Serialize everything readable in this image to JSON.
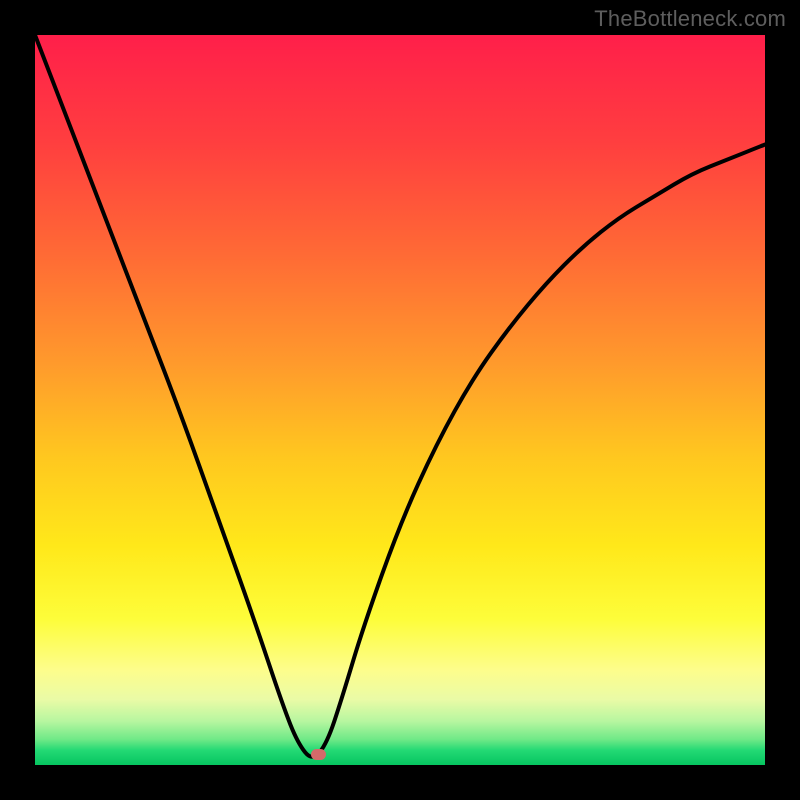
{
  "watermark": "TheBottleneck.com",
  "colors": {
    "frame": "#000000",
    "curve": "#000000",
    "marker": "#d46a6a"
  },
  "chart_data": {
    "type": "line",
    "title": "",
    "xlabel": "",
    "ylabel": "",
    "xlim": [
      0,
      100
    ],
    "ylim": [
      0,
      100
    ],
    "note": "Axes are unlabeled; x/y values below are read as percentage of plot width/height from bottom-left. Curve is a V-shape with minimum near x≈38.",
    "x": [
      0,
      5,
      10,
      15,
      20,
      25,
      30,
      34,
      36,
      38,
      40,
      42,
      45,
      50,
      55,
      60,
      65,
      70,
      75,
      80,
      85,
      90,
      95,
      100
    ],
    "y": [
      100,
      87,
      74,
      61,
      48,
      34,
      20,
      8,
      3,
      0.5,
      3,
      9,
      19,
      33,
      44,
      53,
      60,
      66,
      71,
      75,
      78,
      81,
      83,
      85
    ],
    "marker": {
      "x": 38.7,
      "y": 1.5
    },
    "grid": false,
    "legend": false,
    "background_gradient": {
      "top": "#ff1f4a",
      "mid_upper": "#ff9a2c",
      "mid": "#ffe81a",
      "mid_lower": "#fdfd8c",
      "bottom": "#06c560"
    }
  }
}
